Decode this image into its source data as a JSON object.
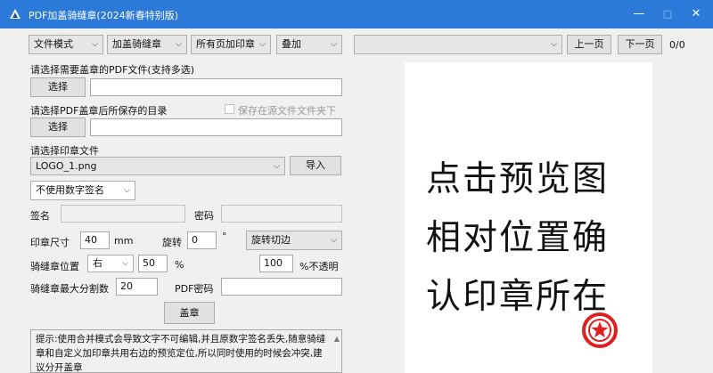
{
  "window": {
    "title": "PDF加盖骑缝章(2024新春特别版)",
    "minimize": "—",
    "maximize": "□",
    "close": "✕",
    "titlebar_color": "#2b79d8"
  },
  "toolbar": {
    "mode": "文件模式",
    "stamp_type": "加盖骑缝章",
    "pages": "所有页加印章",
    "overlay": "叠加",
    "page_select": "",
    "prev": "上一页",
    "next": "下一页",
    "page_count": "0/0"
  },
  "pdf_select": {
    "label": "请选择需要盖章的PDF文件(支持多选)",
    "button": "选择",
    "value": ""
  },
  "output": {
    "label": "请选择PDF盖章后所保存的目录",
    "checkbox_label": "保存在源文件文件夹下",
    "button": "选择",
    "value": ""
  },
  "stamp": {
    "label": "请选择印章文件",
    "file": "LOGO_1.png",
    "import": "导入"
  },
  "signature": {
    "mode": "不使用数字签名",
    "name_label": "签名",
    "password_label": "密码"
  },
  "size": {
    "label": "印章尺寸",
    "value": "40",
    "unit": "mm",
    "rotate_label": "旋转",
    "rotate_value": "0",
    "degree": "°",
    "rotate_mode": "旋转切边"
  },
  "position": {
    "label": "骑缝章位置",
    "side": "右",
    "percent": "50",
    "percent_unit": "%",
    "opacity": "100",
    "opacity_label": "%不透明"
  },
  "split": {
    "label": "骑缝章最大分割数",
    "value": "20",
    "pdf_password_label": "PDF密码"
  },
  "apply_button": "盖章",
  "tip": "提示:使用合并模式会导致文字不可编辑,并且原数字签名丢失,随意骑缝章和自定义加印章共用右边的预览定位,所以同时使用的时候会冲突,建议分开盖章",
  "preview": {
    "lines": [
      "点击预览图",
      "相对位置确",
      "认印章所在"
    ],
    "stamp_color": "#e02020"
  }
}
